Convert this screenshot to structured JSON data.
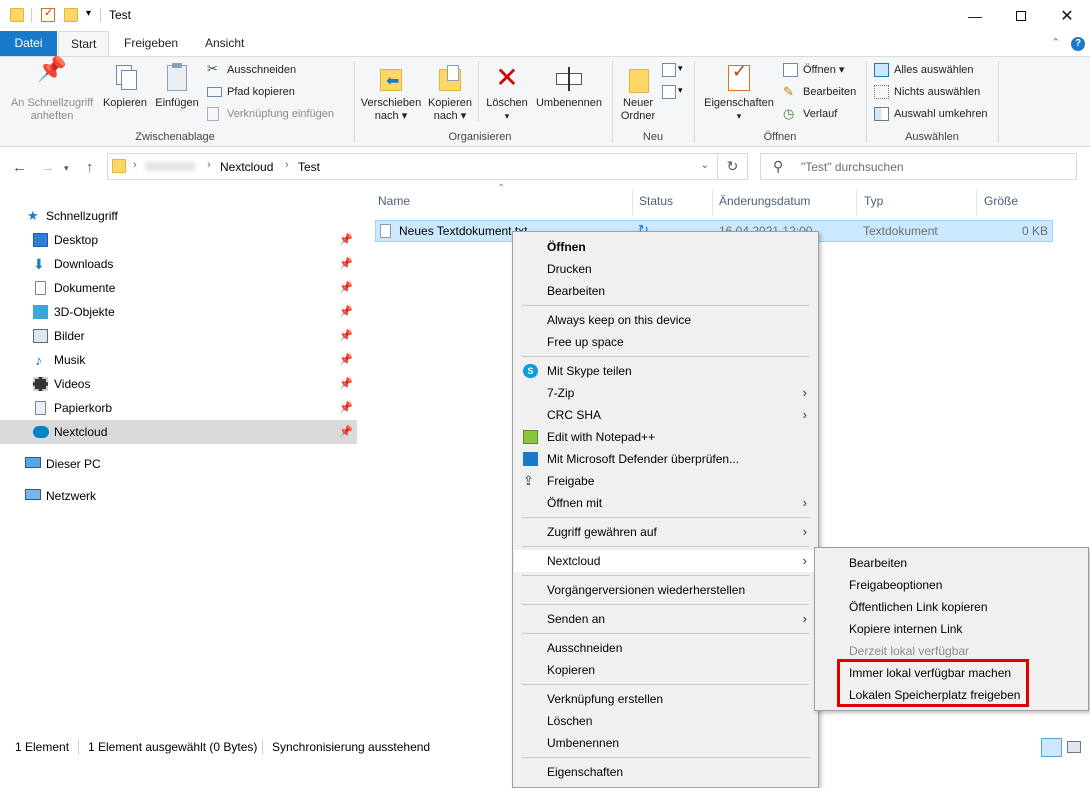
{
  "window": {
    "title": "Test",
    "controls": [
      "minimize",
      "maximize",
      "close"
    ]
  },
  "ribbon": {
    "tabs": [
      "Datei",
      "Start",
      "Freigeben",
      "Ansicht"
    ],
    "active_tab": "Start",
    "clipboard": {
      "label": "Zwischenablage",
      "pin_quick_access": "An Schnellzugriff anheften",
      "copy": "Kopieren",
      "paste": "Einfügen",
      "cut": "Ausschneiden",
      "copy_path": "Pfad kopieren",
      "paste_shortcut": "Verknüpfung einfügen"
    },
    "organize": {
      "label": "Organisieren",
      "move_to": "Verschieben",
      "move_to_2": "nach",
      "copy_to": "Kopieren",
      "copy_to_2": "nach",
      "delete": "Löschen",
      "rename": "Umbenennen"
    },
    "new": {
      "label": "Neu",
      "new_folder": "Neuer",
      "new_folder_2": "Ordner"
    },
    "open": {
      "label": "Öffnen",
      "properties": "Eigenschaften",
      "open": "Öffnen",
      "edit": "Bearbeiten",
      "history": "Verlauf"
    },
    "select": {
      "label": "Auswählen",
      "select_all": "Alles auswählen",
      "select_none": "Nichts auswählen",
      "invert": "Auswahl umkehren"
    }
  },
  "address": {
    "crumbs": [
      "Nextcloud",
      "Test"
    ],
    "search_placeholder": "\"Test\" durchsuchen"
  },
  "nav_pane": {
    "quick_access": "Schnellzugriff",
    "pinned": [
      "Desktop",
      "Downloads",
      "Dokumente",
      "3D-Objekte",
      "Bilder",
      "Musik",
      "Videos",
      "Papierkorb",
      "Nextcloud"
    ],
    "this_pc": "Dieser PC",
    "network": "Netzwerk"
  },
  "columns": [
    "Name",
    "Status",
    "Änderungsdatum",
    "Typ",
    "Größe"
  ],
  "files": [
    {
      "name": "Neues Textdokument.txt",
      "date": "16.04.2021 12:00",
      "type": "Textdokument",
      "size": "0 KB"
    }
  ],
  "status_bar": {
    "count": "1 Element",
    "selected": "1 Element ausgewählt (0 Bytes)",
    "sync": "Synchronisierung ausstehend"
  },
  "context_menu": {
    "open": "Öffnen",
    "print": "Drucken",
    "edit": "Bearbeiten",
    "always_keep": "Always keep on this device",
    "free_up": "Free up space",
    "skype": "Mit Skype teilen",
    "sevenzip": "7-Zip",
    "crc": "CRC SHA",
    "notepadpp": "Edit with Notepad++",
    "defender": "Mit Microsoft Defender überprüfen...",
    "share": "Freigabe",
    "open_with": "Öffnen mit",
    "give_access": "Zugriff gewähren auf",
    "nextcloud": "Nextcloud",
    "restore": "Vorgängerversionen wiederherstellen",
    "send_to": "Senden an",
    "cut": "Ausschneiden",
    "copy": "Kopieren",
    "create_shortcut": "Verknüpfung erstellen",
    "delete": "Löschen",
    "rename": "Umbenennen",
    "properties": "Eigenschaften"
  },
  "submenu": {
    "edit": "Bearbeiten",
    "share_options": "Freigabeoptionen",
    "copy_public_link": "Öffentlichen Link kopieren",
    "copy_internal_link": "Kopiere internen Link",
    "currently_available": "Derzeit lokal verfügbar",
    "always_available": "Immer lokal verfügbar machen",
    "free_space": "Lokalen Speicherplatz freigeben"
  },
  "colors": {
    "accent": "#1979ca",
    "selection": "#cce8ff",
    "highlight_box": "#e00000"
  }
}
